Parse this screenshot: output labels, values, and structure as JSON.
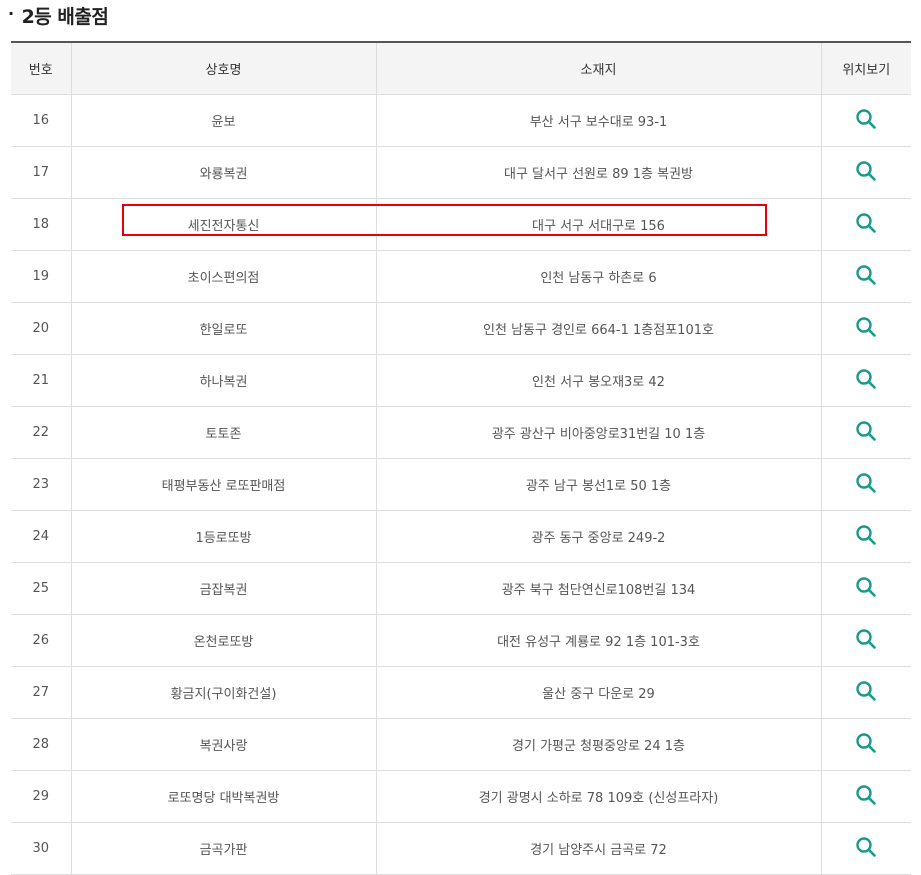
{
  "section": {
    "bullet": "·",
    "title": "2등 배출점"
  },
  "columns": [
    "번호",
    "상호명",
    "소재지",
    "위치보기"
  ],
  "rows": [
    {
      "no": "16",
      "name": "윤보",
      "address": "부산 서구 보수대로 93-1"
    },
    {
      "no": "17",
      "name": "와룡복권",
      "address": "대구 달서구 선원로 89 1층 복권방"
    },
    {
      "no": "18",
      "name": "세진전자통신",
      "address": "대구 서구 서대구로 156"
    },
    {
      "no": "19",
      "name": "초이스편의점",
      "address": "인천 남동구 하촌로 6"
    },
    {
      "no": "20",
      "name": "한일로또",
      "address": "인천 남동구 경인로 664-1 1층점포101호"
    },
    {
      "no": "21",
      "name": "하나복권",
      "address": "인천 서구 봉오재3로 42"
    },
    {
      "no": "22",
      "name": "토토존",
      "address": "광주 광산구 비아중앙로31번길 10 1층"
    },
    {
      "no": "23",
      "name": "태평부동산 로또판매점",
      "address": "광주 남구 봉선1로 50 1층"
    },
    {
      "no": "24",
      "name": "1등로또방",
      "address": "광주 동구 중앙로 249-2"
    },
    {
      "no": "25",
      "name": "금잡복권",
      "address": "광주 북구 첨단연신로108번길 134"
    },
    {
      "no": "26",
      "name": "온천로또방",
      "address": "대전 유성구 계룡로 92 1층 101-3호"
    },
    {
      "no": "27",
      "name": "황금지(구이화건설)",
      "address": "울산 중구 다운로 29"
    },
    {
      "no": "28",
      "name": "복권사랑",
      "address": "경기 가평군 청평중앙로 24 1층"
    },
    {
      "no": "29",
      "name": "로또명당 대박복권방",
      "address": "경기 광명시 소하로 78 109호 (신성프라자)"
    },
    {
      "no": "30",
      "name": "금곡가판",
      "address": "경기 남양주시 금곡로 72"
    }
  ],
  "highlighted_row": "18",
  "icons": {
    "location": "search-icon"
  },
  "colors": {
    "icon": "#1a9a8a",
    "highlight": "#e8000b",
    "header_bg": "#f4f4f4"
  }
}
